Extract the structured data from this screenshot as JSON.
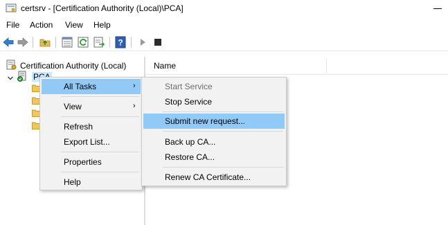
{
  "window": {
    "title": "certsrv - [Certification Authority (Local)\\PCA]"
  },
  "menubar": {
    "items": [
      "File",
      "Action",
      "View",
      "Help"
    ]
  },
  "toolbar": {
    "icons": [
      "back-arrow-icon",
      "forward-arrow-icon",
      "up-folder-icon",
      "show-hide-tree-icon",
      "refresh-icon",
      "export-icon",
      "help-icon",
      "start-service-icon",
      "stop-service-icon"
    ]
  },
  "tree": {
    "root_label": "Certification Authority (Local)",
    "ca_label": "PCA",
    "folder_count": 4
  },
  "list": {
    "column_name": "Name"
  },
  "context_menu": {
    "all_tasks": "All Tasks",
    "view": "View",
    "refresh": "Refresh",
    "export_list": "Export List...",
    "properties": "Properties",
    "help": "Help"
  },
  "submenu": {
    "start_service": "Start Service",
    "stop_service": "Stop Service",
    "submit_new_request": "Submit new request...",
    "back_up_ca": "Back up CA...",
    "restore_ca": "Restore CA...",
    "renew_ca_certificate": "Renew CA Certificate..."
  },
  "colors": {
    "menu_highlight": "#91c9f7",
    "menu_background": "#f2f2f2",
    "disabled_text": "#6d6d6d",
    "tree_selection": "#cce8ff"
  }
}
